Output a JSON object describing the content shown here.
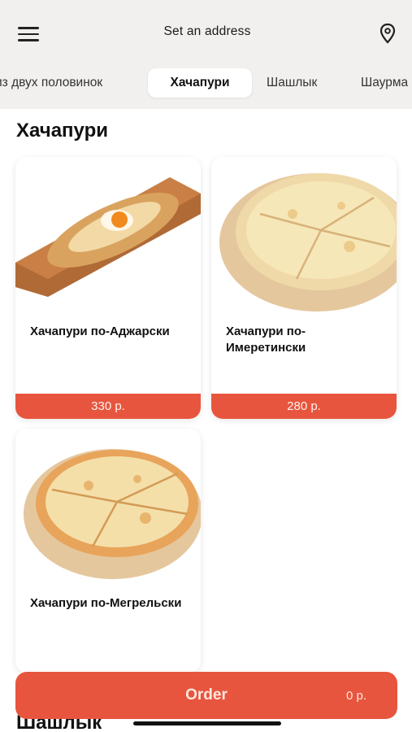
{
  "header": {
    "address_label": "Set an address",
    "menu_icon": "hamburger-menu-icon",
    "location_icon": "map-pin-icon"
  },
  "tabs": [
    {
      "label": "из двух половинок",
      "active": false
    },
    {
      "label": "Хачапури",
      "active": true
    },
    {
      "label": "Шашлык",
      "active": false
    },
    {
      "label": "Шаурма",
      "active": false
    }
  ],
  "sections": [
    {
      "title": "Хачапури",
      "products": [
        {
          "name": "Хачапури по-Аджарски",
          "price": "330 р."
        },
        {
          "name": "Хачапури по-Имеретински",
          "price": "280 р."
        },
        {
          "name": "Хачапури по-Мегрельски",
          "price": ""
        }
      ]
    },
    {
      "title": "Шашлык"
    }
  ],
  "order": {
    "label": "Order",
    "total": "0 р."
  },
  "colors": {
    "accent": "#e8553e",
    "header_bg": "#f1f0ef"
  }
}
